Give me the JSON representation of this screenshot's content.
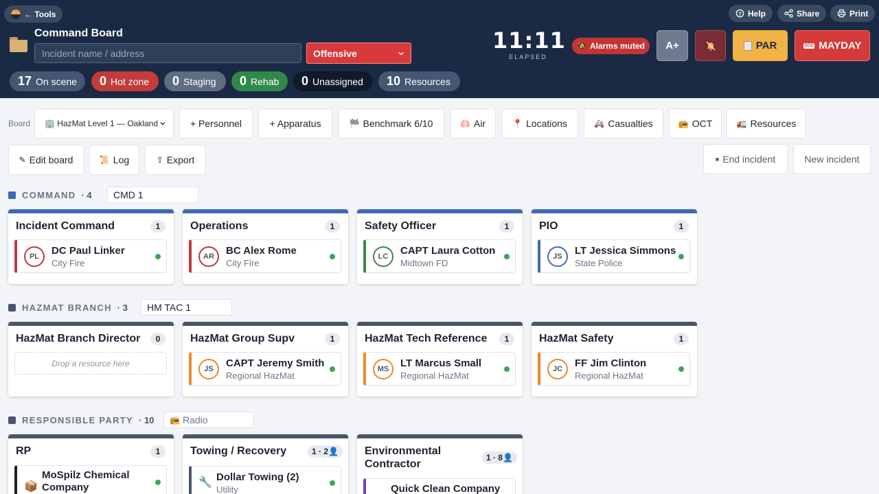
{
  "header": {
    "tools_label": "← Tools",
    "help_label": "Help",
    "share_label": "Share",
    "print_label": "Print",
    "title": "Command Board",
    "incident_placeholder": "Incident name / address",
    "incident_value": "",
    "mode_value": "Offensive",
    "clock": "11:11",
    "elapsed_label": "ELAPSED",
    "alarm_label": "Alarms muted",
    "font_label": "A+",
    "par_label": "PAR",
    "mayday_label": "MAYDAY",
    "mayday_badge": "SOS"
  },
  "status": [
    {
      "count": "17",
      "label": "On scene"
    },
    {
      "count": "0",
      "label": "Hot zone"
    },
    {
      "count": "0",
      "label": "Staging"
    },
    {
      "count": "0",
      "label": "Rehab"
    },
    {
      "count": "0",
      "label": "Unassigned"
    },
    {
      "count": "10",
      "label": "Resources"
    }
  ],
  "toolbar": {
    "board_label": "Board",
    "board_value": "🏢 HazMat Level 1 — Oakland",
    "personnel": "+ Personnel",
    "apparatus": "+ Apparatus",
    "benchmark": "Benchmark 6/10",
    "air": "Air",
    "locations": "Locations",
    "casualties": "Casualties",
    "oct": "OCT",
    "resources": "Resources",
    "edit_board": "Edit board",
    "log": "Log",
    "export": "Export",
    "end_incident": "End incident",
    "new_incident": "New incident"
  },
  "sections": {
    "command": {
      "name": "COMMAND",
      "count": "· 4",
      "chip": "CMD 1",
      "color": "#3c6ab8",
      "cards": [
        {
          "title": "Incident Command",
          "badge": "1",
          "initials": "PL",
          "name": "DC Paul Linker",
          "org": "City Fire"
        },
        {
          "title": "Operations",
          "badge": "1",
          "initials": "AR",
          "name": "BC Alex Rome",
          "org": "City Fire"
        },
        {
          "title": "Safety Officer",
          "badge": "1",
          "initials": "LC",
          "name": "CAPT Laura Cotton",
          "org": "Midtown FD"
        },
        {
          "title": "PIO",
          "badge": "1",
          "initials": "JS",
          "name": "LT Jessica Simmons",
          "org": "State Police"
        }
      ]
    },
    "hazmat": {
      "name": "HAZMAT BRANCH",
      "count": "· 3",
      "chip": "HM TAC 1",
      "color": "#4a5668",
      "cards": [
        {
          "title": "HazMat Branch Director",
          "badge": "0",
          "drop": "Drop a resource here"
        },
        {
          "title": "HazMat Group Supv",
          "badge": "1",
          "initials": "JS",
          "name": "CAPT Jeremy Smith",
          "org": "Regional HazMat"
        },
        {
          "title": "HazMat Tech Reference",
          "badge": "1",
          "initials": "MS",
          "name": "LT Marcus Small",
          "org": "Regional HazMat"
        },
        {
          "title": "HazMat Safety",
          "badge": "1",
          "initials": "JC",
          "name": "FF Jim Clinton",
          "org": "Regional HazMat"
        }
      ]
    },
    "rp": {
      "name": "RESPONSIBLE PARTY",
      "count": "· 10",
      "chip": "Radio",
      "color": "#4a5668",
      "cards": [
        {
          "title": "RP",
          "badge": "1",
          "name": "MoSpilz Chemical Company",
          "org": ""
        },
        {
          "title": "Towing / Recovery",
          "badge": "1 · 2👤",
          "name": "Dollar Towing (2)",
          "org": "Utility"
        },
        {
          "title": "Environmental Contractor",
          "badge": "1 · 8👤",
          "name": "Quick Clean Company",
          "org": ""
        }
      ]
    }
  },
  "colors": {
    "header_bg": "#1b2a44",
    "command_accent": "#3c6ab8",
    "ic_red": "#c0393b",
    "safety_green": "#3a8a46",
    "pio_blue": "#3c6ab8",
    "hazmat_orange": "#e88a2e",
    "online": "#3aa55a",
    "mayday": "#d43a3a",
    "par": "#f3b245"
  }
}
